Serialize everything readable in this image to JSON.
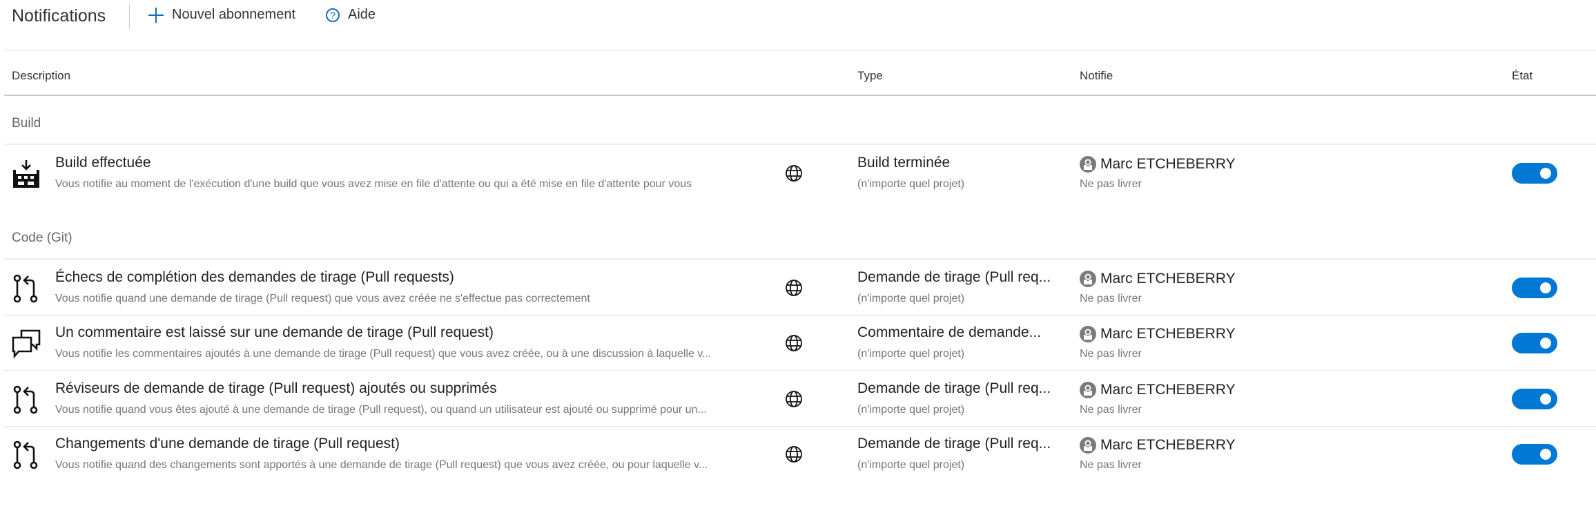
{
  "header": {
    "title": "Notifications",
    "new_subscription_label": "Nouvel abonnement",
    "help_label": "Aide"
  },
  "columns": {
    "description": "Description",
    "type": "Type",
    "notifies": "Notifie",
    "state": "État"
  },
  "groups": [
    {
      "title": "Build",
      "rows": [
        {
          "icon": "build-icon",
          "title": "Build effectuée",
          "description": "Vous notifie au moment de l'exécution d'une build que vous avez mise en file d'attente ou qui a été mise en file d'attente pour vous",
          "scope_icon": "globe-icon",
          "type": "Build terminée",
          "scope": "(n'importe quel projet)",
          "subscriber": "Marc ETCHEBERRY",
          "delivery": "Ne pas livrer",
          "enabled": true
        }
      ]
    },
    {
      "title": "Code (Git)",
      "rows": [
        {
          "icon": "pull-request-icon",
          "title": "Échecs de complétion des demandes de tirage (Pull requests)",
          "description": "Vous notifie quand une demande de tirage (Pull request) que vous avez créée ne s'effectue pas correctement",
          "scope_icon": "globe-icon",
          "type": "Demande de tirage (Pull req...",
          "scope": "(n'importe quel projet)",
          "subscriber": "Marc ETCHEBERRY",
          "delivery": "Ne pas livrer",
          "enabled": true
        },
        {
          "icon": "comment-icon",
          "title": "Un commentaire est laissé sur une demande de tirage (Pull request)",
          "description": "Vous notifie les commentaires ajoutés à une demande de tirage (Pull request) que vous avez créée, ou à une discussion à laquelle v...",
          "scope_icon": "globe-icon",
          "type": "Commentaire de demande...",
          "scope": "(n'importe quel projet)",
          "subscriber": "Marc ETCHEBERRY",
          "delivery": "Ne pas livrer",
          "enabled": true
        },
        {
          "icon": "pull-request-icon",
          "title": "Réviseurs de demande de tirage (Pull request) ajoutés ou supprimés",
          "description": "Vous notifie quand vous êtes ajouté à une demande de tirage (Pull request), ou quand un utilisateur est ajouté ou supprimé pour un...",
          "scope_icon": "globe-icon",
          "type": "Demande de tirage (Pull req...",
          "scope": "(n'importe quel projet)",
          "subscriber": "Marc ETCHEBERRY",
          "delivery": "Ne pas livrer",
          "enabled": true
        },
        {
          "icon": "pull-request-icon",
          "title": "Changements d'une demande de tirage (Pull request)",
          "description": "Vous notifie quand des changements sont apportés à une demande de tirage (Pull request) que vous avez créée, ou pour laquelle v...",
          "scope_icon": "globe-icon",
          "type": "Demande de tirage (Pull req...",
          "scope": "(n'importe quel projet)",
          "subscriber": "Marc ETCHEBERRY",
          "delivery": "Ne pas livrer",
          "enabled": true
        }
      ]
    }
  ],
  "colors": {
    "accent": "#0078d4",
    "icon_blue": "#106ebe",
    "secondary_text": "#767676"
  }
}
